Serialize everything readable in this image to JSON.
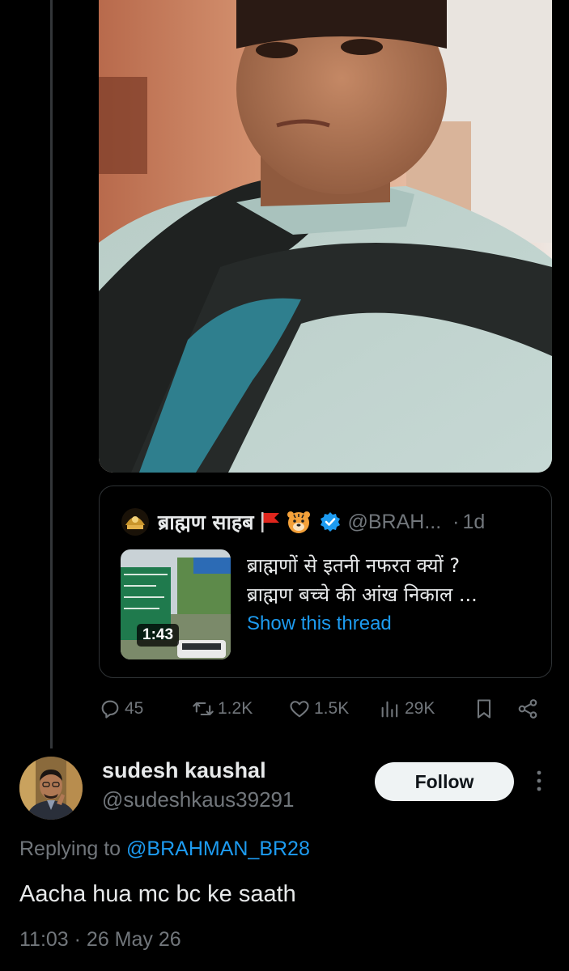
{
  "quoted_tweet": {
    "author_name": "ब्राह्मण साहब",
    "handle": "@BRAH...",
    "separator": "·",
    "time": "1d",
    "text_line1": "ब्राह्मणों से इतनी नफरत क्यों ?",
    "text_line2": "ब्राह्मण बच्चे की आंख निकाल ...",
    "show_thread": "Show this thread",
    "video_duration": "1:43",
    "emoji_icons": [
      "red-flag-icon",
      "tiger-face-icon",
      "verified-badge-icon"
    ]
  },
  "actions": {
    "replies": "45",
    "reposts": "1.2K",
    "likes": "1.5K",
    "views": "29K"
  },
  "reply": {
    "author_name": "sudesh kaushal",
    "handle": "@sudeshkaus39291",
    "follow_label": "Follow",
    "replying_prefix": "Replying to",
    "replying_to": "@BRAHMAN_BR28",
    "text": "Aacha hua mc bc ke saath",
    "timestamp": "11:03 · 26 May 26"
  },
  "colors": {
    "background": "#000000",
    "text_primary": "#e7e9ea",
    "text_secondary": "#71767b",
    "link": "#1d9bf0",
    "border": "#2f3336"
  }
}
